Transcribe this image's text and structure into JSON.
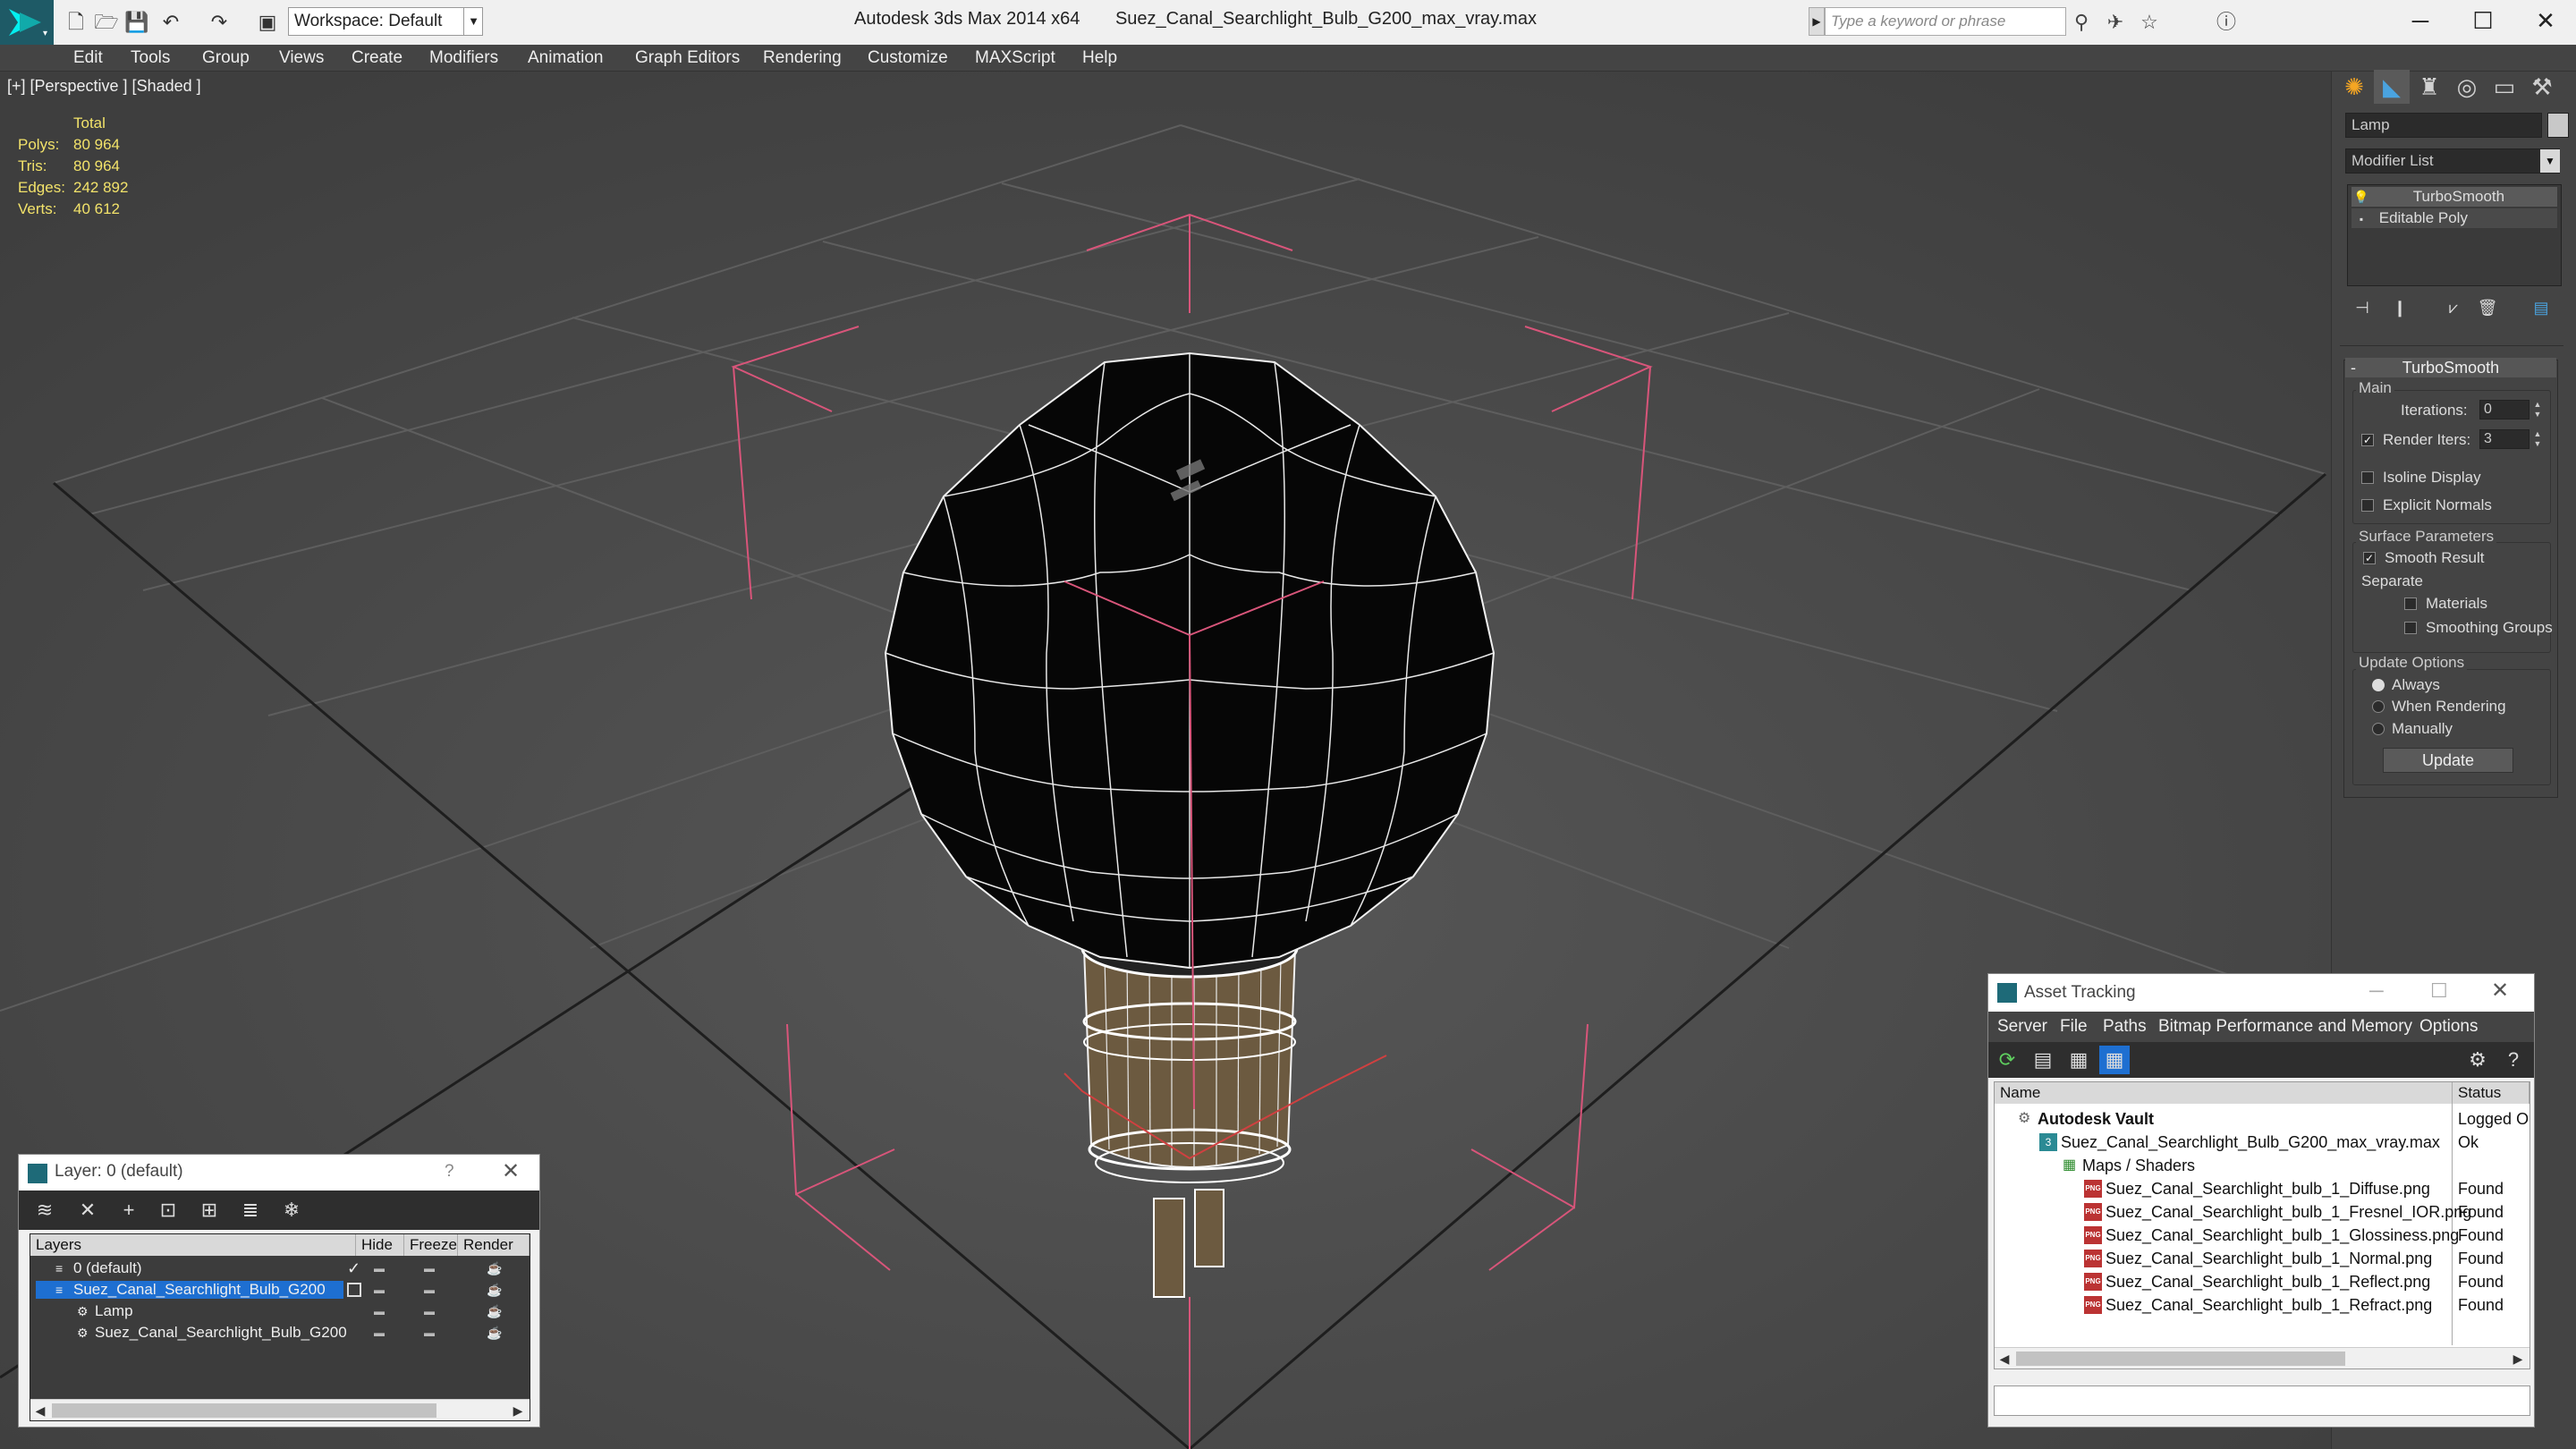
{
  "app": {
    "title": "Autodesk 3ds Max  2014 x64",
    "file": "Suez_Canal_Searchlight_Bulb_G200_max_vray.max",
    "workspace": "Workspace: Default",
    "search_placeholder": "Type a keyword or phrase"
  },
  "menu": [
    "Edit",
    "Tools",
    "Group",
    "Views",
    "Create",
    "Modifiers",
    "Animation",
    "Graph Editors",
    "Rendering",
    "Customize",
    "MAXScript",
    "Help"
  ],
  "viewport": {
    "label": "[+] [Perspective ] [Shaded ]",
    "stats": {
      "header": "Total",
      "rows": [
        {
          "label": "Polys:",
          "value": "80 964"
        },
        {
          "label": "Tris:",
          "value": "80 964"
        },
        {
          "label": "Edges:",
          "value": "242 892"
        },
        {
          "label": "Verts:",
          "value": "40 612"
        }
      ]
    }
  },
  "command_panel": {
    "object_name": "Lamp",
    "modifier_list": "Modifier List",
    "stack": [
      "TurboSmooth",
      "Editable Poly"
    ],
    "rollout_title": "TurboSmooth",
    "main_label": "Main",
    "iterations_label": "Iterations:",
    "iterations_value": "0",
    "render_iters_label": "Render Iters:",
    "render_iters_value": "3",
    "isoline_label": "Isoline Display",
    "explicit_normals_label": "Explicit Normals",
    "surface_params_label": "Surface Parameters",
    "smooth_result_label": "Smooth Result",
    "separate_label": "Separate",
    "materials_label": "Materials",
    "smoothing_groups_label": "Smoothing Groups",
    "update_options_label": "Update Options",
    "always_label": "Always",
    "when_rendering_label": "When Rendering",
    "manually_label": "Manually",
    "update_button": "Update"
  },
  "layer_window": {
    "title": "Layer: 0 (default)",
    "help": "?",
    "columns": [
      "Layers",
      "Hide",
      "Freeze",
      "Render"
    ],
    "rows": [
      {
        "name": "0 (default)",
        "indent": 0,
        "selected": false
      },
      {
        "name": "Suez_Canal_Searchlight_Bulb_G200",
        "indent": 0,
        "selected": true
      },
      {
        "name": "Lamp",
        "indent": 1,
        "selected": false
      },
      {
        "name": "Suez_Canal_Searchlight_Bulb_G200",
        "indent": 1,
        "selected": false
      }
    ]
  },
  "asset_window": {
    "title": "Asset Tracking",
    "menu": [
      "Server",
      "File",
      "Paths",
      "Bitmap Performance and Memory",
      "Options"
    ],
    "columns": [
      "Name",
      "Status"
    ],
    "rows": [
      {
        "name": "Autodesk Vault",
        "status": "Logged O",
        "indent": 0
      },
      {
        "name": "Suez_Canal_Searchlight_Bulb_G200_max_vray.max",
        "status": "Ok",
        "indent": 1
      },
      {
        "name": "Maps / Shaders",
        "status": "",
        "indent": 2
      },
      {
        "name": "Suez_Canal_Searchlight_bulb_1_Diffuse.png",
        "status": "Found",
        "indent": 3
      },
      {
        "name": "Suez_Canal_Searchlight_bulb_1_Fresnel_IOR.png",
        "status": "Found",
        "indent": 3
      },
      {
        "name": "Suez_Canal_Searchlight_bulb_1_Glossiness.png",
        "status": "Found",
        "indent": 3
      },
      {
        "name": "Suez_Canal_Searchlight_bulb_1_Normal.png",
        "status": "Found",
        "indent": 3
      },
      {
        "name": "Suez_Canal_Searchlight_bulb_1_Reflect.png",
        "status": "Found",
        "indent": 3
      },
      {
        "name": "Suez_Canal_Searchlight_bulb_1_Refract.png",
        "status": "Found",
        "indent": 3
      }
    ]
  }
}
